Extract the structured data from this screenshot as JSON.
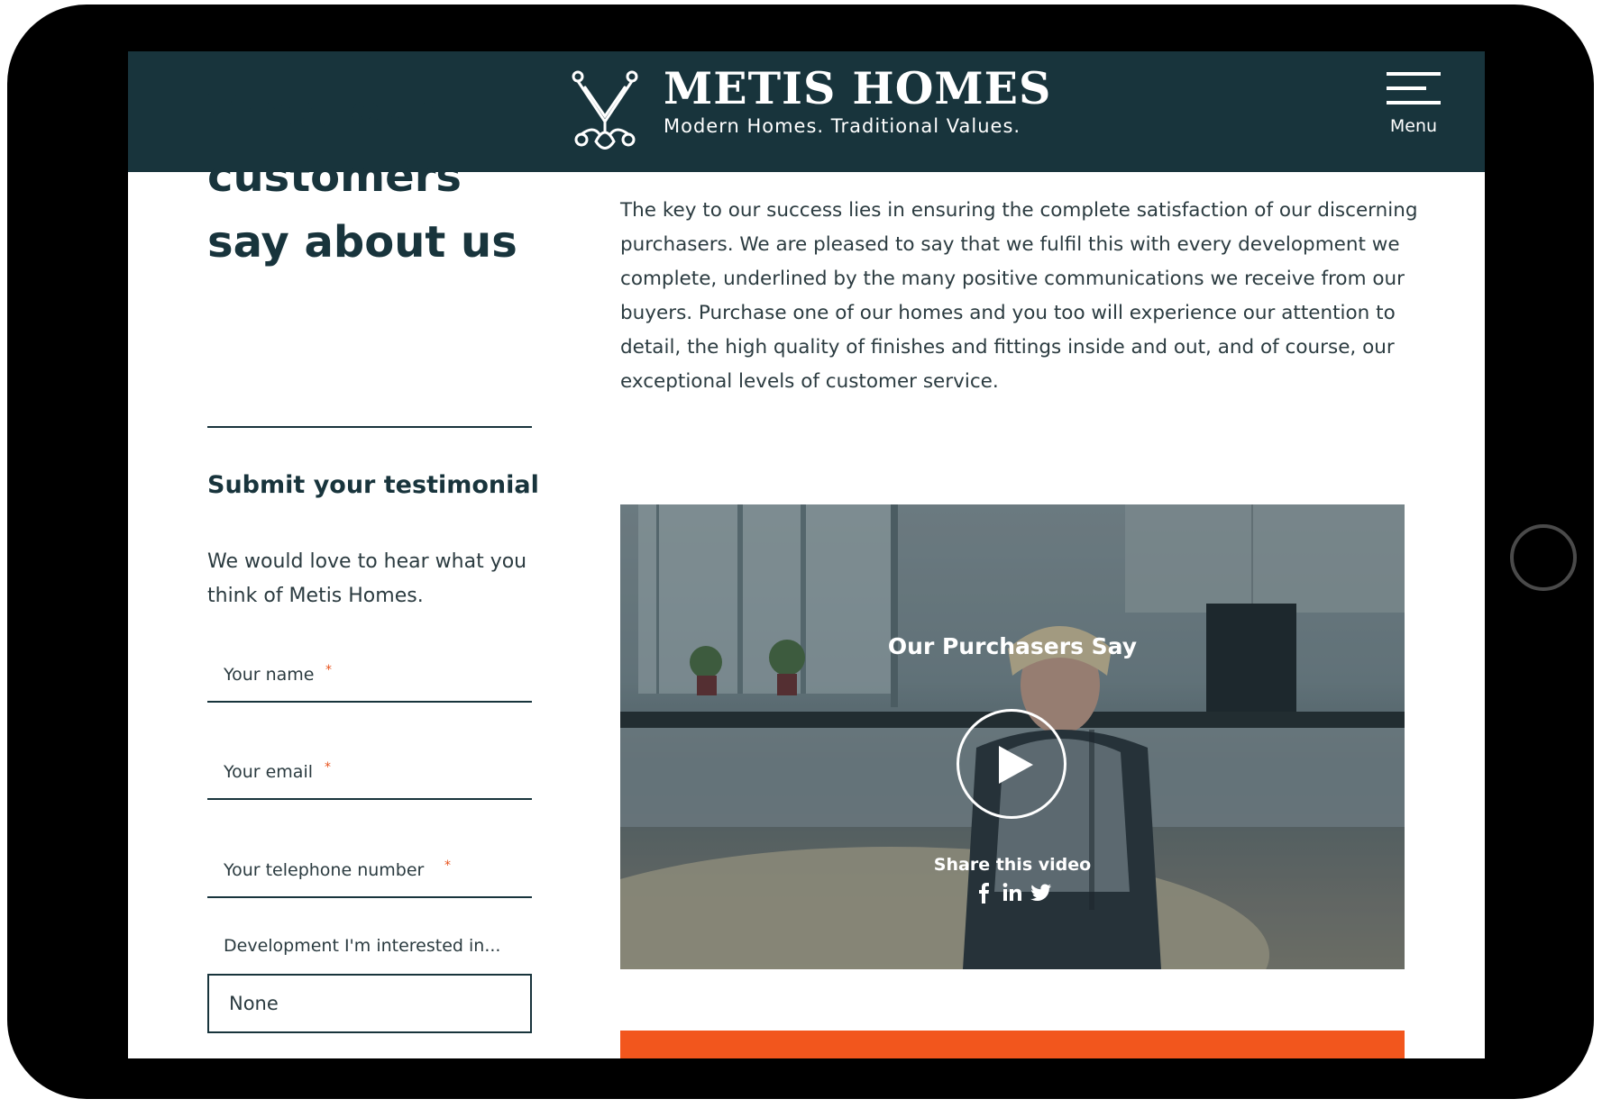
{
  "brand": {
    "name": "METIS HOMES",
    "tagline": "Modern Homes. Traditional Values."
  },
  "header": {
    "menu_label": "Menu"
  },
  "main": {
    "title": "What our customers say about us",
    "description": "The key to our success lies in ensuring the complete satisfaction of our discerning purchasers. We are pleased to say that we fulfil this with every development we complete, underlined by the many positive communications we receive from our buyers. Purchase one of our homes and you too will experience our attention to detail, the high quality of finishes and fittings inside and out, and of course, our exceptional levels of customer service."
  },
  "testimonial_form": {
    "heading": "Submit your testimonial",
    "intro": "We would love to hear what you think of Metis Homes.",
    "name_placeholder": "Your name",
    "email_placeholder": "Your email",
    "phone_placeholder": "Your telephone number",
    "required_marker": "*",
    "development_label": "Development I'm interested in...",
    "development_value": "None"
  },
  "video": {
    "title": "Our Purchasers Say",
    "share_label": "Share this video",
    "share_icons": [
      "facebook-icon",
      "linkedin-icon",
      "twitter-icon"
    ]
  },
  "colors": {
    "header_bg": "#18343c",
    "text_dark": "#18343c",
    "accent_orange": "#f2561d",
    "required_red": "#e8541e"
  }
}
